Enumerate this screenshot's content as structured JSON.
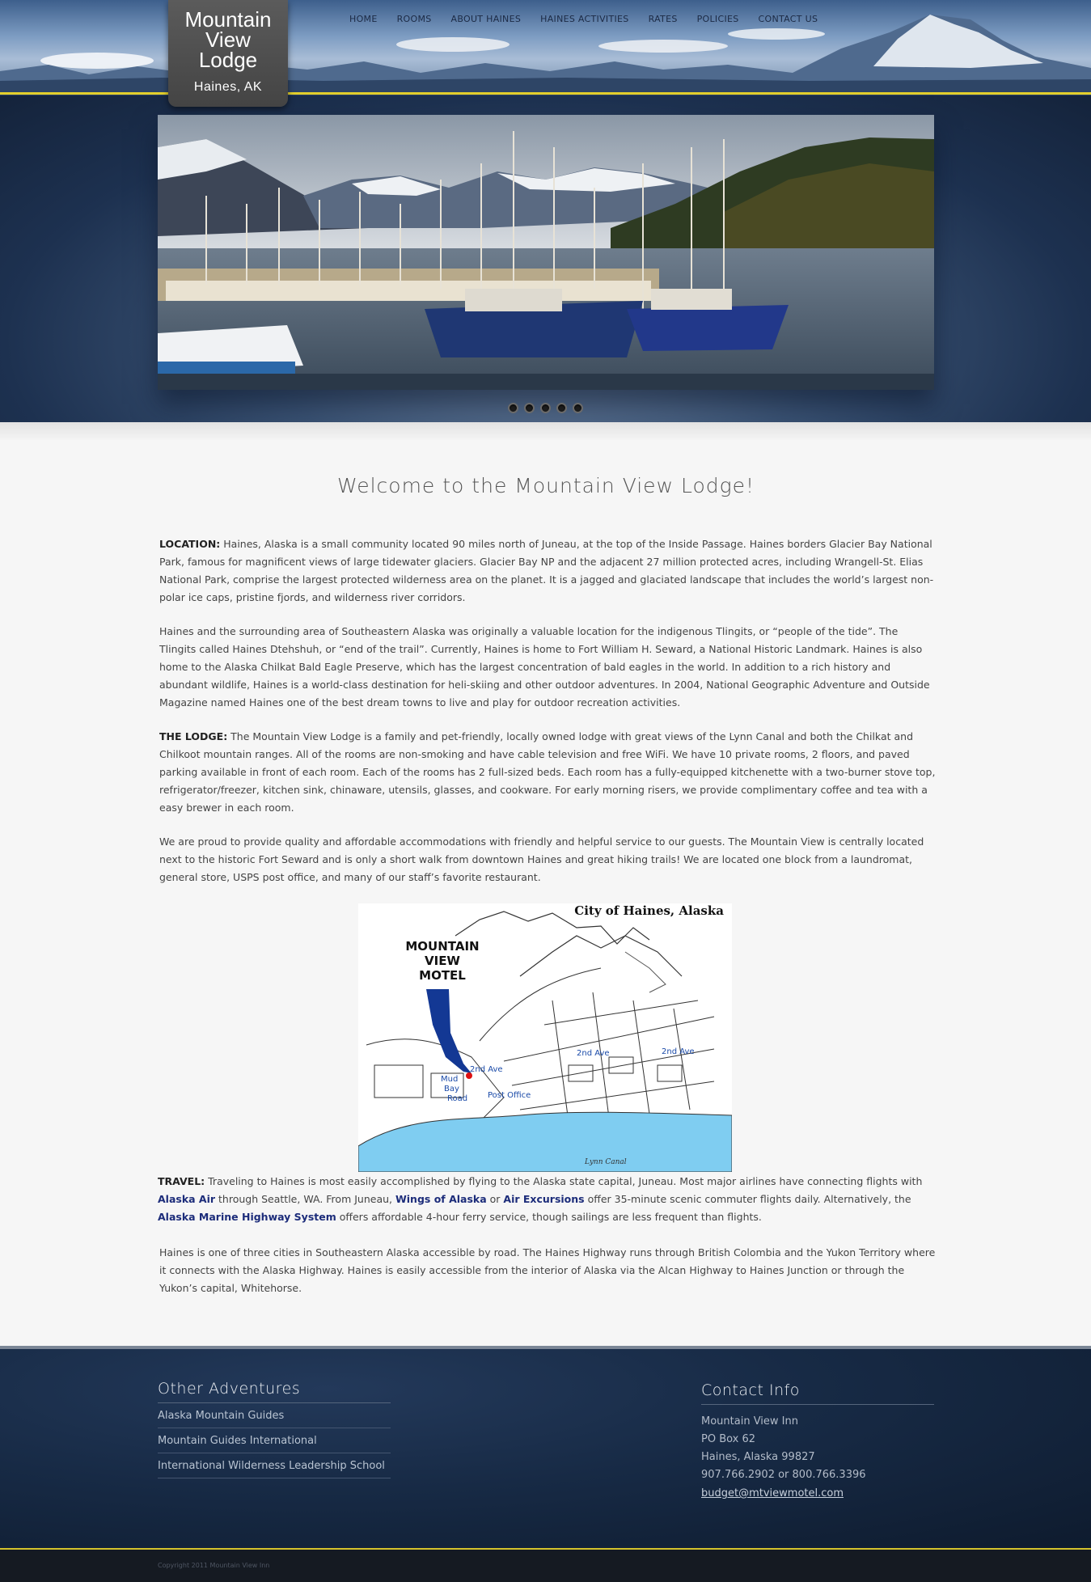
{
  "logo": {
    "line1": "Mountain",
    "line2": "View",
    "line3": "Lodge",
    "location": "Haines, AK"
  },
  "nav": [
    "HOME",
    "ROOMS",
    "ABOUT HAINES",
    "HAINES ACTIVITIES",
    "RATES",
    "POLICIES",
    "CONTACT US"
  ],
  "slider": {
    "dot_count": 5
  },
  "welcome": "Welcome to the Mountain View Lodge!",
  "sections": {
    "location_label": "LOCATION:",
    "location_text": " Haines, Alaska is a small community located 90 miles north of Juneau, at the top of the Inside Passage.  Haines borders Glacier Bay National Park, famous for magnificent views of large tidewater glaciers.  Glacier Bay NP and the adjacent 27 million protected acres, including Wrangell-St. Elias National Park, comprise the largest protected wilderness area on the planet.  It is a jagged and glaciated landscape that includes the world’s largest non-polar ice caps, pristine fjords, and wilderness river corridors.",
    "history_text": "Haines and the surrounding area of Southeastern Alaska was originally a valuable location for the indigenous Tlingits, or “people of the tide”.  The Tlingits called Haines Dtehshuh, or “end of the trail”.  Currently, Haines is home to Fort William H. Seward, a National Historic Landmark.  Haines is also home to the Alaska Chilkat Bald Eagle Preserve, which has the largest concentration of bald eagles in the world.  In addition to a rich history and abundant wildlife, Haines is a world-class destination for heli-skiing and other outdoor adventures.  In 2004, National Geographic Adventure and Outside Magazine named Haines one of the best dream towns to live and play for outdoor recreation activities.",
    "lodge_label": "THE LODGE:",
    "lodge_text": " The Mountain View Lodge is a family and pet-friendly, locally owned lodge with great views of the Lynn Canal and both the Chilkat and Chilkoot mountain ranges.  All of the rooms are non-smoking and have cable television and free WiFi.  We have 10 private rooms, 2 floors, and paved parking available in front of each room.  Each of the rooms has 2 full-sized beds.  Each room has a fully-equipped kitchenette with a two-burner stove top, refrigerator/freezer, kitchen sink, chinaware, utensils, glasses, and cookware.  For early morning risers, we provide complimentary coffee and tea with a easy brewer in each room.",
    "service_text": "We are proud to provide quality and affordable accommodations with friendly and helpful service to our guests.  The Mountain View is centrally located next to the historic Fort Seward and is only a short walk from downtown Haines and great hiking trails!  We are located one block from a laundromat, general store, USPS post office, and many of our staff’s favorite restaurant.",
    "travel_label": "TRAVEL:",
    "travel_t1": " Traveling to Haines is most easily accomplished by flying to the Alaska state capital,  Juneau.  Most major airlines have connecting flights with ",
    "travel_link1": "Alaska Air",
    "travel_t2": " through Seattle, WA.  From Juneau, ",
    "travel_link2": "Wings of Alaska",
    "travel_t3": " or ",
    "travel_link3": "Air Excursions",
    "travel_t4": " offer 35-minute scenic commuter flights daily.  Alternatively, the ",
    "travel_link4": "Alaska Marine Highway System",
    "travel_t5": " offers affordable 4-hour ferry service, though sailings are less frequent than flights.",
    "road_text": "Haines is one of three cities in Southeastern Alaska accessible by road.  The Haines Highway runs through British Colombia and the Yukon Territory where it connects with the Alaska Highway.  Haines is easily accessible from the interior of Alaska via the Alcan Highway to Haines Junction or through the Yukon’s capital, Whitehorse."
  },
  "map": {
    "title": "City of Haines, Alaska",
    "motel_l1": "MOUNTAIN",
    "motel_l2": "VIEW",
    "motel_l3": "MOTEL",
    "label_2nd_a": "2nd Ave",
    "label_2nd_b": "2nd Ave",
    "label_2nd_c": "2nd Ave",
    "label_mud": "Mud",
    "label_bay": "Bay",
    "label_road": "Road",
    "label_post": "Post Office",
    "label_canal": "Lynn Canal"
  },
  "footer": {
    "adventures_title": "Other Adventures",
    "adventures": [
      "Alaska Mountain Guides",
      "Mountain Guides International",
      "International Wilderness Leadership School"
    ],
    "contact_title": "Contact Info",
    "contact_name": "Mountain View Inn",
    "contact_po": "PO Box 62",
    "contact_city": "Haines, Alaska 99827",
    "contact_phone": "907.766.2902 or 800.766.3396",
    "contact_email": "budget@mtviewmotel.com",
    "copyright": "Copyright 2011 Mountain View Inn"
  },
  "colors": {
    "accent_yellow": "#e3cf2c",
    "link_blue": "#1c2c7a",
    "footer_bg": "#172a45"
  }
}
